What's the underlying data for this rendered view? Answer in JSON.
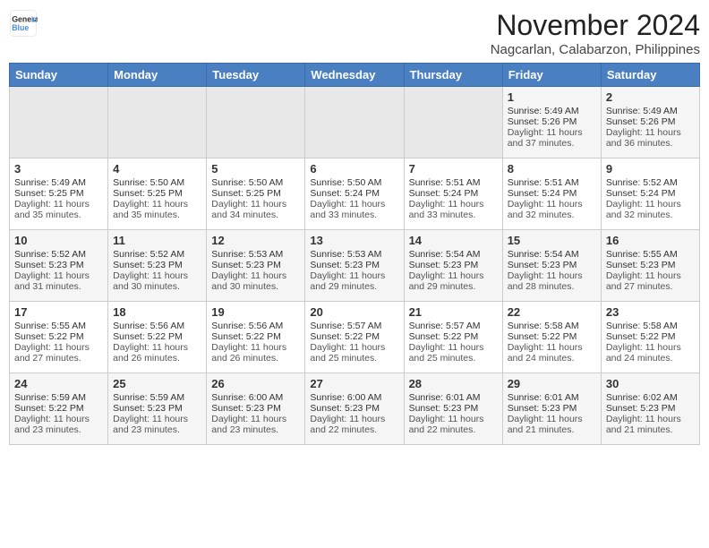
{
  "header": {
    "logo_line1": "General",
    "logo_line2": "Blue",
    "title": "November 2024",
    "subtitle": "Nagcarlan, Calabarzon, Philippines"
  },
  "days_of_week": [
    "Sunday",
    "Monday",
    "Tuesday",
    "Wednesday",
    "Thursday",
    "Friday",
    "Saturday"
  ],
  "weeks": [
    [
      {
        "day": "",
        "info": ""
      },
      {
        "day": "",
        "info": ""
      },
      {
        "day": "",
        "info": ""
      },
      {
        "day": "",
        "info": ""
      },
      {
        "day": "",
        "info": ""
      },
      {
        "day": "1",
        "info": "Sunrise: 5:49 AM\nSunset: 5:26 PM\nDaylight: 11 hours and 37 minutes."
      },
      {
        "day": "2",
        "info": "Sunrise: 5:49 AM\nSunset: 5:26 PM\nDaylight: 11 hours and 36 minutes."
      }
    ],
    [
      {
        "day": "3",
        "info": "Sunrise: 5:49 AM\nSunset: 5:25 PM\nDaylight: 11 hours and 35 minutes."
      },
      {
        "day": "4",
        "info": "Sunrise: 5:50 AM\nSunset: 5:25 PM\nDaylight: 11 hours and 35 minutes."
      },
      {
        "day": "5",
        "info": "Sunrise: 5:50 AM\nSunset: 5:25 PM\nDaylight: 11 hours and 34 minutes."
      },
      {
        "day": "6",
        "info": "Sunrise: 5:50 AM\nSunset: 5:24 PM\nDaylight: 11 hours and 33 minutes."
      },
      {
        "day": "7",
        "info": "Sunrise: 5:51 AM\nSunset: 5:24 PM\nDaylight: 11 hours and 33 minutes."
      },
      {
        "day": "8",
        "info": "Sunrise: 5:51 AM\nSunset: 5:24 PM\nDaylight: 11 hours and 32 minutes."
      },
      {
        "day": "9",
        "info": "Sunrise: 5:52 AM\nSunset: 5:24 PM\nDaylight: 11 hours and 32 minutes."
      }
    ],
    [
      {
        "day": "10",
        "info": "Sunrise: 5:52 AM\nSunset: 5:23 PM\nDaylight: 11 hours and 31 minutes."
      },
      {
        "day": "11",
        "info": "Sunrise: 5:52 AM\nSunset: 5:23 PM\nDaylight: 11 hours and 30 minutes."
      },
      {
        "day": "12",
        "info": "Sunrise: 5:53 AM\nSunset: 5:23 PM\nDaylight: 11 hours and 30 minutes."
      },
      {
        "day": "13",
        "info": "Sunrise: 5:53 AM\nSunset: 5:23 PM\nDaylight: 11 hours and 29 minutes."
      },
      {
        "day": "14",
        "info": "Sunrise: 5:54 AM\nSunset: 5:23 PM\nDaylight: 11 hours and 29 minutes."
      },
      {
        "day": "15",
        "info": "Sunrise: 5:54 AM\nSunset: 5:23 PM\nDaylight: 11 hours and 28 minutes."
      },
      {
        "day": "16",
        "info": "Sunrise: 5:55 AM\nSunset: 5:23 PM\nDaylight: 11 hours and 27 minutes."
      }
    ],
    [
      {
        "day": "17",
        "info": "Sunrise: 5:55 AM\nSunset: 5:22 PM\nDaylight: 11 hours and 27 minutes."
      },
      {
        "day": "18",
        "info": "Sunrise: 5:56 AM\nSunset: 5:22 PM\nDaylight: 11 hours and 26 minutes."
      },
      {
        "day": "19",
        "info": "Sunrise: 5:56 AM\nSunset: 5:22 PM\nDaylight: 11 hours and 26 minutes."
      },
      {
        "day": "20",
        "info": "Sunrise: 5:57 AM\nSunset: 5:22 PM\nDaylight: 11 hours and 25 minutes."
      },
      {
        "day": "21",
        "info": "Sunrise: 5:57 AM\nSunset: 5:22 PM\nDaylight: 11 hours and 25 minutes."
      },
      {
        "day": "22",
        "info": "Sunrise: 5:58 AM\nSunset: 5:22 PM\nDaylight: 11 hours and 24 minutes."
      },
      {
        "day": "23",
        "info": "Sunrise: 5:58 AM\nSunset: 5:22 PM\nDaylight: 11 hours and 24 minutes."
      }
    ],
    [
      {
        "day": "24",
        "info": "Sunrise: 5:59 AM\nSunset: 5:22 PM\nDaylight: 11 hours and 23 minutes."
      },
      {
        "day": "25",
        "info": "Sunrise: 5:59 AM\nSunset: 5:23 PM\nDaylight: 11 hours and 23 minutes."
      },
      {
        "day": "26",
        "info": "Sunrise: 6:00 AM\nSunset: 5:23 PM\nDaylight: 11 hours and 23 minutes."
      },
      {
        "day": "27",
        "info": "Sunrise: 6:00 AM\nSunset: 5:23 PM\nDaylight: 11 hours and 22 minutes."
      },
      {
        "day": "28",
        "info": "Sunrise: 6:01 AM\nSunset: 5:23 PM\nDaylight: 11 hours and 22 minutes."
      },
      {
        "day": "29",
        "info": "Sunrise: 6:01 AM\nSunset: 5:23 PM\nDaylight: 11 hours and 21 minutes."
      },
      {
        "day": "30",
        "info": "Sunrise: 6:02 AM\nSunset: 5:23 PM\nDaylight: 11 hours and 21 minutes."
      }
    ]
  ]
}
